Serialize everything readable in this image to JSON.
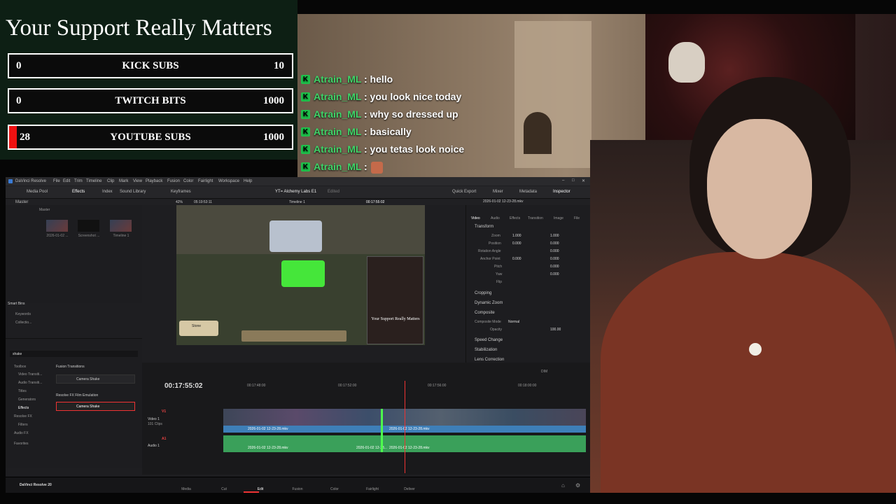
{
  "support_panel": {
    "title": "Your Support Really Matters",
    "goals": [
      {
        "current": "0",
        "label": "KICK SUBS",
        "target": "10",
        "progress": 0
      },
      {
        "current": "0",
        "label": "TWITCH BITS",
        "target": "1000",
        "progress": 0
      },
      {
        "current": "28",
        "label": "YOUTUBE SUBS",
        "target": "1000",
        "progress": 0.028
      }
    ]
  },
  "chat": {
    "messages": [
      {
        "user": "Atrain_ML",
        "text": ": hello"
      },
      {
        "user": "Atrain_ML",
        "text": ": you look nice today"
      },
      {
        "user": "Atrain_ML",
        "text": ": why so dressed up"
      },
      {
        "user": "Atrain_ML",
        "text": ": basically"
      },
      {
        "user": "Atrain_ML",
        "text": ": you tetas look noice"
      },
      {
        "user": "Atrain_ML",
        "text": ":"
      }
    ]
  },
  "resolve": {
    "app_title": "DaVinci Resolve",
    "menu": [
      "File",
      "Edit",
      "Trim",
      "Timeline",
      "Clip",
      "Mark",
      "View",
      "Playback",
      "Fusion",
      "Color",
      "Fairlight",
      "Workspace",
      "Help"
    ],
    "toolbar": {
      "media_pool": "Media Pool",
      "effects": "Effects",
      "index": "Index",
      "sound_library": "Sound Library",
      "keyframes": "Keyframes",
      "project": "YT= Alchemy Labs E1",
      "edited": "Edited",
      "quick_export": "Quick Export",
      "mixer": "Mixer",
      "metadata": "Metadata",
      "inspector": "Inspector"
    },
    "media_pool": {
      "master": "Master",
      "bin": "Master",
      "clips": [
        "2026-01-02 ...",
        "Screenshot ...",
        "Timeline 1"
      ],
      "smart_bins": "Smart Bins",
      "keywords": "Keywords",
      "collections": "Collectio..."
    },
    "viewer": {
      "zoom": "42%",
      "timecode_left": "05:19:53:11",
      "timeline": "Timeline 1",
      "timecode_right": "00:17:55:02",
      "stone_label": "Stone",
      "pip_title": "Your Support Really Matters"
    },
    "inspector": {
      "clip": "2026-01-02 12-23-28.mkv",
      "tabs": [
        "Video",
        "Audio",
        "Effects",
        "Transition",
        "Image",
        "File"
      ],
      "transform": "Transform",
      "zoom": "Zoom",
      "zoom_x": "1.000",
      "zoom_y": "1.000",
      "position": "Position",
      "pos_x": "0.000",
      "pos_y": "0.000",
      "rotation": "Rotation Angle",
      "rotation_val": "0.000",
      "anchor": "Anchor Point",
      "anchor_x": "0.000",
      "anchor_y": "0.000",
      "pitch": "Pitch",
      "pitch_val": "0.000",
      "yaw": "Yaw",
      "yaw_val": "0.000",
      "flip": "Flip",
      "cropping": "Cropping",
      "dynamic_zoom": "Dynamic Zoom",
      "composite": "Composite",
      "composite_mode": "Composite Mode",
      "composite_mode_val": "Normal",
      "opacity": "Opacity",
      "opacity_val": "100.00",
      "speed_change": "Speed Change",
      "stabilization": "Stabilization",
      "lens_correction": "Lens Correction"
    },
    "effects": {
      "search_value": "shake",
      "tree": [
        "Toolbox",
        "Video Transiti...",
        "Audio Transiti...",
        "Titles",
        "Generators",
        "Effects",
        "Resolve FX",
        "Filters",
        "Audio FX",
        "Favorites"
      ],
      "fusion_transitions": "Fusion Transitions",
      "camera_shake_1": "Camera Shake",
      "resolve_fx_film": "Resolve FX Film Emulation",
      "camera_shake_2": "Camera Shake"
    },
    "timeline": {
      "timecode": "00:17:55:02",
      "ruler": [
        "00:17:48:00",
        "00:17:52:00",
        "00:17:56:00",
        "00:18:00:00"
      ],
      "v1": "V1",
      "video1": "Video 1",
      "clip_count": "101 Clips",
      "a1": "A1",
      "audio1": "Audio 1",
      "clip_name": "2026-01-02 12-23-28.mkv",
      "clip_short": "20...",
      "clip_mid": "2026-01-02 12-23...",
      "db": "DIM"
    },
    "pages": [
      "Media",
      "Cut",
      "Edit",
      "Fusion",
      "Color",
      "Fairlight",
      "Deliver"
    ],
    "brand": "DaVinci Resolve 20"
  }
}
